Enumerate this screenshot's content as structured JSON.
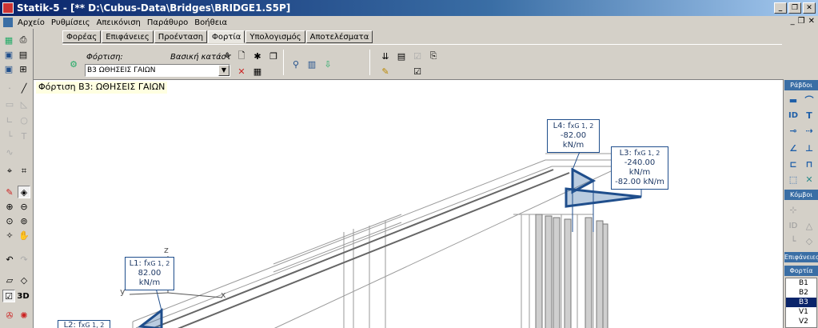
{
  "window": {
    "title": "Statik-5 - [** D:\\Cubus-Data\\Bridges\\BRIDGE1.S5P]"
  },
  "menu": {
    "items": [
      "Αρχείο",
      "Ρυθμίσεις",
      "Απεικόνιση",
      "Παράθυρο",
      "Βοήθεια"
    ]
  },
  "tabs": [
    "Φορέας",
    "Επιφάνειες",
    "Προένταση",
    "Φορτία",
    "Υπολογισμός",
    "Αποτελέσματα"
  ],
  "active_tab": "Φορτία",
  "load": {
    "label": "Φόρτιση:",
    "basic_label": "Βασική κατάστ",
    "selected": "B3  ΩΘΗΣΕΙΣ ΓΑΙΩΝ"
  },
  "viewport": {
    "title": "Φόρτιση B3: ΩΘΗΣΕΙΣ ΓΑΙΩΝ",
    "axes": {
      "z": "z",
      "y": "y",
      "x": "x"
    },
    "callouts": [
      {
        "name": "L4",
        "label": "L4: f",
        "sub": "xG 1, 2",
        "lines": [
          "-82.00 kN/m"
        ]
      },
      {
        "name": "L3",
        "label": "L3: f",
        "sub": "xG 1, 2",
        "lines": [
          "-240.00 kN/m",
          "-82.00 kN/m"
        ]
      },
      {
        "name": "L1",
        "label": "L1: f",
        "sub": "xG 1, 2",
        "lines": [
          "82.00 kN/m"
        ]
      },
      {
        "name": "L2",
        "label": "L2: f",
        "sub": "xG 1, 2",
        "lines": []
      }
    ]
  },
  "right_panel": {
    "sections": [
      "Ράβδοι",
      "Κόμβοι",
      "Επιφάνειες",
      "Φορτία"
    ],
    "load_cases": [
      "B1",
      "B2",
      "B3",
      "V1",
      "V2"
    ],
    "selected_case": "B3"
  },
  "colors": {
    "title_bar": "#0a246a",
    "accent": "#1f4e8c",
    "panel_header": "#3a6ea5",
    "wireframe": "#9a9a9a"
  }
}
